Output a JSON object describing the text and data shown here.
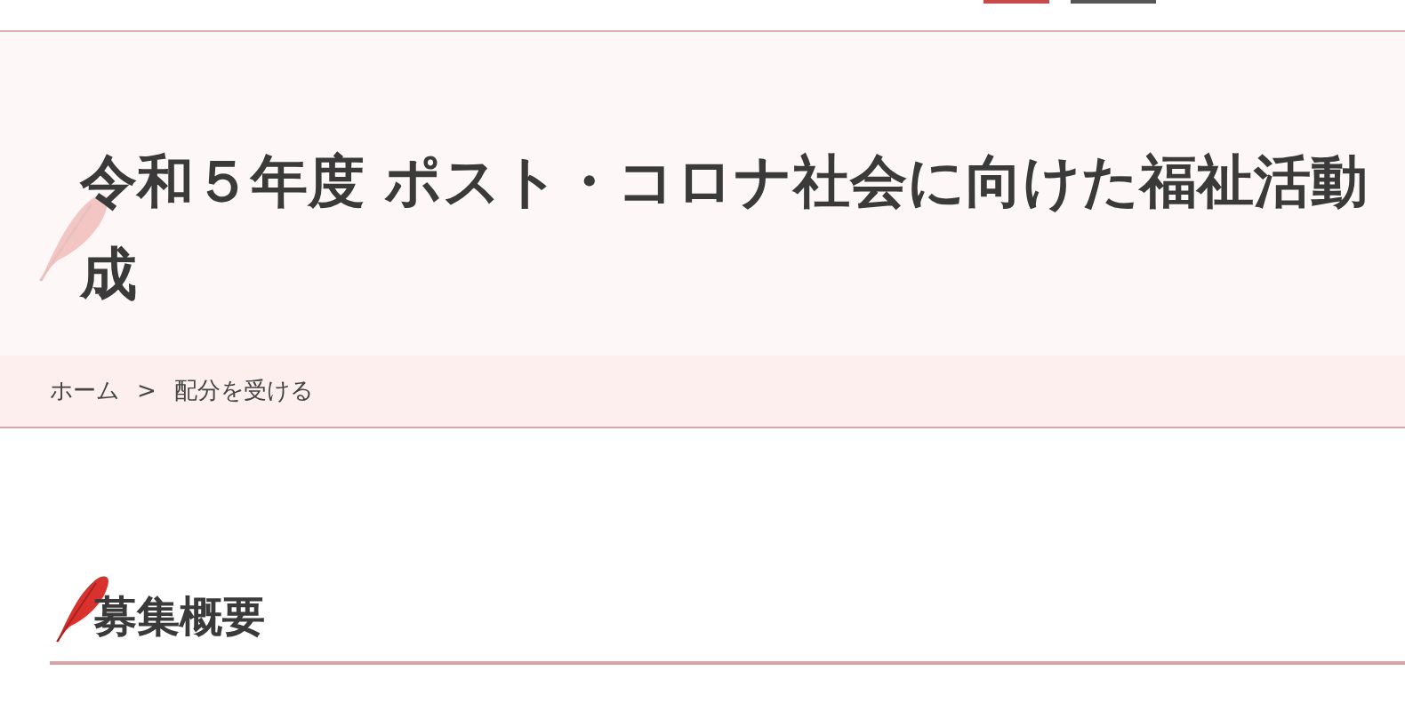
{
  "header_buttons": [
    {
      "kind": "accent"
    },
    {
      "kind": "dark"
    }
  ],
  "page_title": {
    "lines": [
      "令和５年度 ポスト・コロナ社会に向けた福祉活動",
      "成"
    ]
  },
  "breadcrumb": [
    {
      "label": "ホーム"
    },
    {
      "label": "配分を受ける"
    }
  ],
  "breadcrumb_separator": ">",
  "section_heading": "募集概要"
}
